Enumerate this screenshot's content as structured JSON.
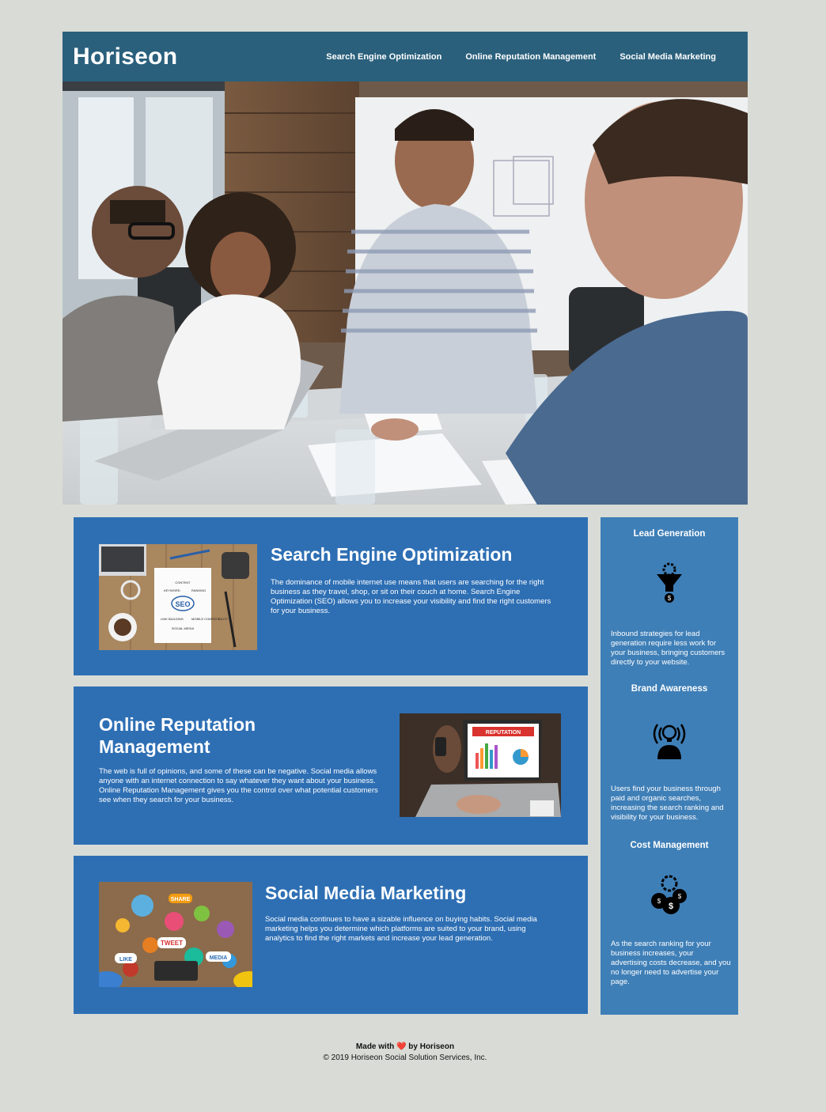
{
  "header": {
    "logo": "Horiseon",
    "nav": [
      {
        "label": "Search Engine Optimization"
      },
      {
        "label": "Online Reputation Management"
      },
      {
        "label": "Social Media Marketing"
      }
    ]
  },
  "sections": {
    "seo": {
      "title": "Search Engine Optimization",
      "body": "The dominance of mobile internet use means that users are searching for the right business as they travel, shop, or sit on their couch at home. Search Engine Optimization (SEO) allows you to increase your visibility and find the right customers for your business.",
      "image_labels": [
        "SEO",
        "CONTENT",
        "KEYWORD",
        "RANKING",
        "LINK BUILDING",
        "MOBILE COMPATIBILITY",
        "SOCIAL MEDIA"
      ]
    },
    "orm": {
      "title_line1": "Online Reputation",
      "title_line2": "Management",
      "body": "The web is full of opinions, and some of these can be negative. Social media allows anyone with an internet connection to say whatever they want about your business. Online Reputation Management gives you the control over what potential customers see when they search for your business.",
      "image_label": "REPUTATION"
    },
    "smm": {
      "title": "Social Media Marketing",
      "body": "Social media continues to have a sizable influence on buying habits. Social media marketing helps you determine which platforms are suited to your brand, using analytics to find the right markets and increase your lead generation.",
      "image_labels": [
        "SHARE",
        "TWEET",
        "LIKE",
        "MEDIA"
      ]
    }
  },
  "sidebar": {
    "items": [
      {
        "title": "Lead Generation",
        "icon": "funnel-icon",
        "text": "Inbound strategies for lead generation require less work for your business, bringing customers directly to your website."
      },
      {
        "title": "Brand Awareness",
        "icon": "broadcast-person-icon",
        "text": "Users find your business through paid and organic searches, increasing the search ranking and visibility for your business."
      },
      {
        "title": "Cost Management",
        "icon": "coins-gear-icon",
        "text": "As the search ranking for your business increases, your advertising costs decrease, and you no longer need to advertise your page."
      }
    ]
  },
  "footer": {
    "made_prefix": "Made with",
    "heart": "❤️",
    "made_suffix": "by Horiseon",
    "copyright": "© 2019 Horiseon Social Solution Services, Inc."
  },
  "colors": {
    "header": "#2a607c",
    "card": "#2e6fb4",
    "sidebar": "#3f7fb7",
    "page_bg": "#d9dcd6"
  }
}
